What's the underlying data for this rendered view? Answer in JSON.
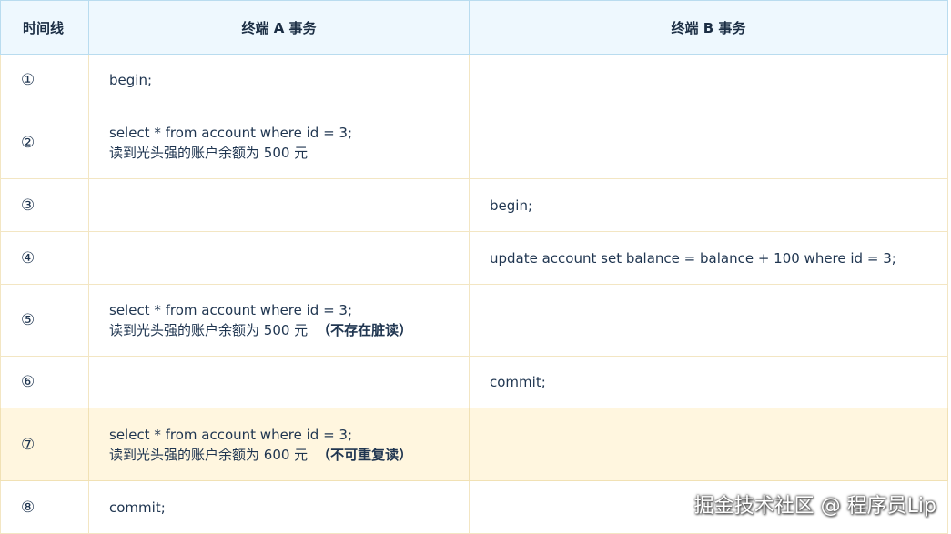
{
  "headers": {
    "col1": "时间线",
    "col2": "终端 A 事务",
    "col3": "终端 B 事务"
  },
  "rows": [
    {
      "step": "①",
      "a": [
        "begin;"
      ],
      "a_note": "",
      "b": ""
    },
    {
      "step": "②",
      "a": [
        "select * from account where id = 3;",
        "读到光头强的账户余额为 500 元"
      ],
      "a_note": "",
      "b": ""
    },
    {
      "step": "③",
      "a": [],
      "a_note": "",
      "b": "begin;"
    },
    {
      "step": "④",
      "a": [],
      "a_note": "",
      "b": "update account set balance = balance + 100 where id = 3;"
    },
    {
      "step": "⑤",
      "a": [
        "select * from account where id = 3;",
        "读到光头强的账户余额为 500 元"
      ],
      "a_note": "（不存在脏读）",
      "b": ""
    },
    {
      "step": "⑥",
      "a": [],
      "a_note": "",
      "b": "commit;"
    },
    {
      "step": "⑦",
      "a": [
        "select * from account where id = 3;",
        "读到光头强的账户余额为 600 元"
      ],
      "a_note": "（不可重复读）",
      "b": "",
      "highlighted": true
    },
    {
      "step": "⑧",
      "a": [
        "commit;"
      ],
      "a_note": "",
      "b": ""
    }
  ],
  "watermark": "掘金技术社区 @ 程序员Lip",
  "colors": {
    "header_bg": "#eef8fe",
    "highlight_bg": "#fff6df",
    "border": "#f3e6c3"
  }
}
